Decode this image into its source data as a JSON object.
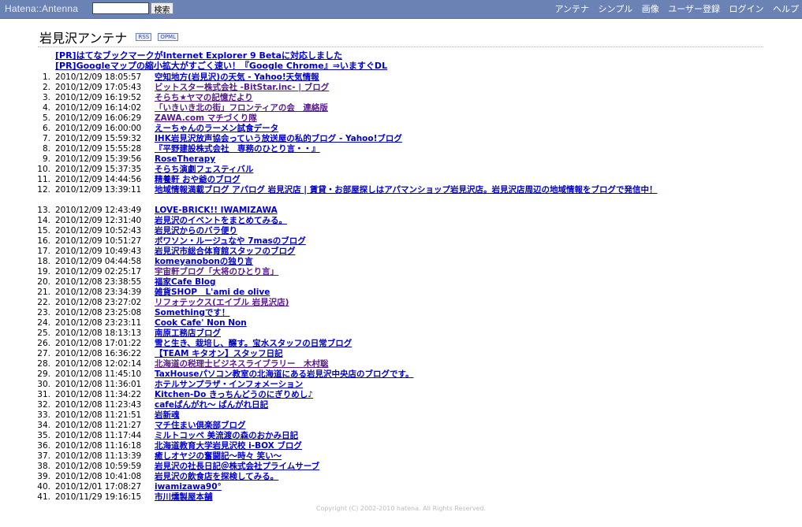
{
  "header": {
    "logo": "Hatena::Antenna",
    "search_placeholder": "",
    "search_button": "検索",
    "nav": [
      "アンテナ",
      "シンプル",
      "画像",
      "ユーザー登録",
      "ログイン",
      "ヘルプ"
    ]
  },
  "page": {
    "title": "岩見沢アンテナ",
    "rss": "RSS",
    "opml": "OPML"
  },
  "pr": [
    "[PR]はてなブックマークがInternet Explorer 9 Betaに対応しました",
    "[PR]Googleマップの縮小拡大がすごく速い！『Google Chrome』⇒いますぐDL"
  ],
  "items": [
    {
      "num": "1.",
      "time": "2010/12/09 18:05:57",
      "title": "空知地方(岩見沢)の天気 - Yahoo!天気情報",
      "visited": false
    },
    {
      "num": "2.",
      "time": "2010/12/09 17:05:43",
      "title": "ビットスター株式会社 -BitStar.inc- | ブログ",
      "visited": true
    },
    {
      "num": "3.",
      "time": "2010/12/09 16:19:52",
      "title": "そらち★ヤマの記憶だより",
      "visited": true
    },
    {
      "num": "4.",
      "time": "2010/12/09 16:14:02",
      "title": "「いきいき北の街」フロンティアの会　連絡版",
      "visited": true
    },
    {
      "num": "5.",
      "time": "2010/12/09 16:06:29",
      "title": "ZAWA.com マチづくり隊",
      "visited": true
    },
    {
      "num": "6.",
      "time": "2010/12/09 16:00:00",
      "title": "えーちゃんのラーメン試食データ",
      "visited": false
    },
    {
      "num": "7.",
      "time": "2010/12/09 15:59:32",
      "title": "IHK岩見沢放声協会っていう放送屋の私的ブログ - Yahoo!ブログ",
      "visited": false
    },
    {
      "num": "8.",
      "time": "2010/12/09 15:55:28",
      "title": "『平野建設株式会社　専務のひとり言・・』",
      "visited": false
    },
    {
      "num": "9.",
      "time": "2010/12/09 15:39:56",
      "title": "RoseTherapy",
      "visited": false
    },
    {
      "num": "10.",
      "time": "2010/12/09 15:37:35",
      "title": "そらち演劇フェスティバル",
      "visited": false
    },
    {
      "num": "11.",
      "time": "2010/12/09 14:44:56",
      "title": "精養軒 おや爺のブログ",
      "visited": false
    },
    {
      "num": "12.",
      "time": "2010/12/09 13:39:11",
      "title": "地域情報満載ブログ アパログ 岩見沢店 | 賃貸・お部屋探しはアパマンショップ岩見沢店。岩見沢店周辺の地域情報をブログで発信中！",
      "visited": false,
      "wrap": true
    },
    {
      "num": "13.",
      "time": "2010/12/09 12:43:49",
      "title": "LOVE-BRICK!! IWAMIZAWA",
      "visited": false
    },
    {
      "num": "14.",
      "time": "2010/12/09 12:31:40",
      "title": "岩見沢のイベントをまとめてみる。",
      "visited": false
    },
    {
      "num": "15.",
      "time": "2010/12/09 10:52:43",
      "title": "岩見沢からのバラ便り",
      "visited": false
    },
    {
      "num": "16.",
      "time": "2010/12/09 10:51:27",
      "title": "ボワソン・ルージュなや 7masのブログ",
      "visited": false
    },
    {
      "num": "17.",
      "time": "2010/12/09 10:49:43",
      "title": "岩見沢市総合体育館スタッフのブログ",
      "visited": false
    },
    {
      "num": "18.",
      "time": "2010/12/09 04:44:58",
      "title": "komeyanobonの独り言",
      "visited": false
    },
    {
      "num": "19.",
      "time": "2010/12/09 02:25:17",
      "title": "宇宙軒ブログ「大将のひとり言」",
      "visited": true
    },
    {
      "num": "20.",
      "time": "2010/12/08 23:38:55",
      "title": "福家Cafe Blog",
      "visited": false
    },
    {
      "num": "21.",
      "time": "2010/12/08 23:34:39",
      "title": "雑貨SHOP　L'ami de olive",
      "visited": false
    },
    {
      "num": "22.",
      "time": "2010/12/08 23:27:02",
      "title": "リフォテックス(エイブル 岩見沢店)",
      "visited": true
    },
    {
      "num": "23.",
      "time": "2010/12/08 23:25:08",
      "title": "Somethingです！",
      "visited": false
    },
    {
      "num": "24.",
      "time": "2010/12/08 23:23:11",
      "title": "Cook Cafe' Non Non",
      "visited": false
    },
    {
      "num": "25.",
      "time": "2010/12/08 18:13:13",
      "title": "南原工務店ブログ",
      "visited": false
    },
    {
      "num": "26.",
      "time": "2010/12/08 17:01:22",
      "title": "雪と生き、栽培し、醸す。宝水スタッフの日常ブログ",
      "visited": false
    },
    {
      "num": "27.",
      "time": "2010/12/08 16:36:22",
      "title": "【TEAM キタオン】スタッフ日記",
      "visited": false
    },
    {
      "num": "28.",
      "time": "2010/12/08 12:02:14",
      "title": "北海道の税理士ビジネスライブラリー　木村聡",
      "visited": true
    },
    {
      "num": "29.",
      "time": "2010/12/08 11:45:10",
      "title": "TaxHouseパソコン教室の北海道にある岩見沢中央店のブログです。",
      "visited": false
    },
    {
      "num": "30.",
      "time": "2010/12/08 11:36:01",
      "title": "ホテルサンプラザ・インフォメーション",
      "visited": false
    },
    {
      "num": "31.",
      "time": "2010/12/08 11:34:22",
      "title": "Kitchen-Do きっちんどうのにぎりめし♪",
      "visited": false
    },
    {
      "num": "32.",
      "time": "2010/12/08 11:23:43",
      "title": "cafeぱんがれ～ ぱんがれ日記",
      "visited": false
    },
    {
      "num": "33.",
      "time": "2010/12/08 11:21:51",
      "title": "岩新魂",
      "visited": false
    },
    {
      "num": "34.",
      "time": "2010/12/08 11:21:27",
      "title": "マチ住まい倶楽部ブログ",
      "visited": false
    },
    {
      "num": "35.",
      "time": "2010/12/08 11:17:44",
      "title": "ミルトコッペ 美流渡の森のおかみ日記",
      "visited": false
    },
    {
      "num": "36.",
      "time": "2010/12/08 11:16:18",
      "title": "北海道教育大学岩見沢校 i-BOX ブログ",
      "visited": false
    },
    {
      "num": "37.",
      "time": "2010/12/08 11:13:39",
      "title": "癒しオヤジの奮闘記～時々 笑い～",
      "visited": false
    },
    {
      "num": "38.",
      "time": "2010/12/08 10:59:59",
      "title": "岩見沢の社長日記＠株式会社プライムサーブ",
      "visited": false
    },
    {
      "num": "39.",
      "time": "2010/12/08 10:41:08",
      "title": "岩見沢の飲食店を探検してみる。",
      "visited": false
    },
    {
      "num": "40.",
      "time": "2010/12/01 17:08:27",
      "title": "iwamizawa90°",
      "visited": false
    },
    {
      "num": "41.",
      "time": "2010/11/29 19:16:15",
      "title": "市川燻製屋本舗",
      "visited": false
    }
  ],
  "footer": "Copyright (C) 2002-2010 hatena. All Rights Reserved."
}
